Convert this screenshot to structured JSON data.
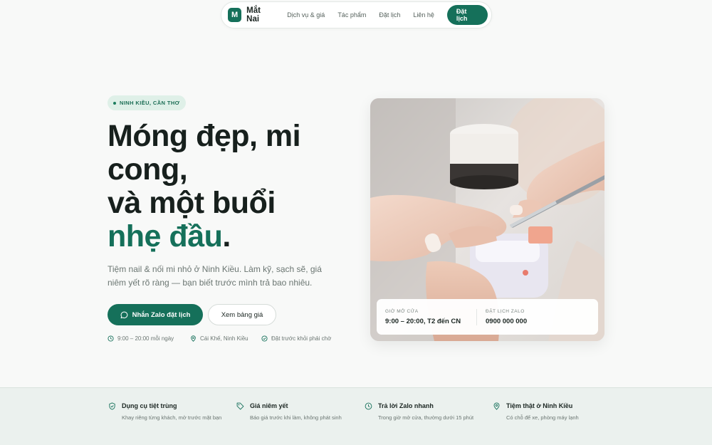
{
  "nav": {
    "logo_letter": "M",
    "brand": "Mắt Nai",
    "links": [
      "Dịch vụ & giá",
      "Tác phẩm",
      "Đặt lịch",
      "Liên hệ"
    ],
    "cta": "Đặt lịch"
  },
  "hero": {
    "badge": "NINH KIỀU, CẦN THƠ",
    "headline_line1": "Móng đẹp, mi",
    "headline_line2": "cong,",
    "headline_line3": "và một buổi",
    "headline_accent": "nhẹ đầu",
    "headline_end": ".",
    "lead": "Tiệm nail & nối mi nhỏ ở Ninh Kiều. Làm kỹ, sạch sẽ, giá niêm yết rõ ràng — bạn biết trước mình trả bao nhiêu.",
    "primary_button": "Nhắn Zalo đặt lịch",
    "secondary_button": "Xem bảng giá",
    "meta": [
      {
        "icon": "clock-icon",
        "text": "9:00 – 20:00 mỗi ngày"
      },
      {
        "icon": "map-pin-icon",
        "text": "Cái Khế, Ninh Kiều"
      },
      {
        "icon": "check-circle-icon",
        "text": "Đặt trước khỏi phải chờ"
      }
    ]
  },
  "photo_card": {
    "hours_label": "GIỜ MỞ CỬA",
    "hours_value": "9:00 – 20:00, T2 đến CN",
    "zalo_label": "ĐẶT LỊCH ZALO",
    "zalo_value": "0900 000 000"
  },
  "features": [
    {
      "icon": "shield-check-icon",
      "title": "Dụng cụ tiệt trùng",
      "desc": "Khay riêng từng khách, mở trước mặt bạn"
    },
    {
      "icon": "tag-icon",
      "title": "Giá niêm yết",
      "desc": "Báo giá trước khi làm, không phát sinh"
    },
    {
      "icon": "clock-icon",
      "title": "Trả lời Zalo nhanh",
      "desc": "Trong giờ mở cửa, thường dưới 15 phút"
    },
    {
      "icon": "map-pin-icon",
      "title": "Tiệm thật ở Ninh Kiều",
      "desc": "Có chỗ để xe, phòng máy lạnh"
    }
  ],
  "colors": {
    "accent": "#15705a",
    "badge_bg": "#dff0e8",
    "page_bg": "#f8f9f8",
    "strip_bg": "#ebf1ee"
  }
}
